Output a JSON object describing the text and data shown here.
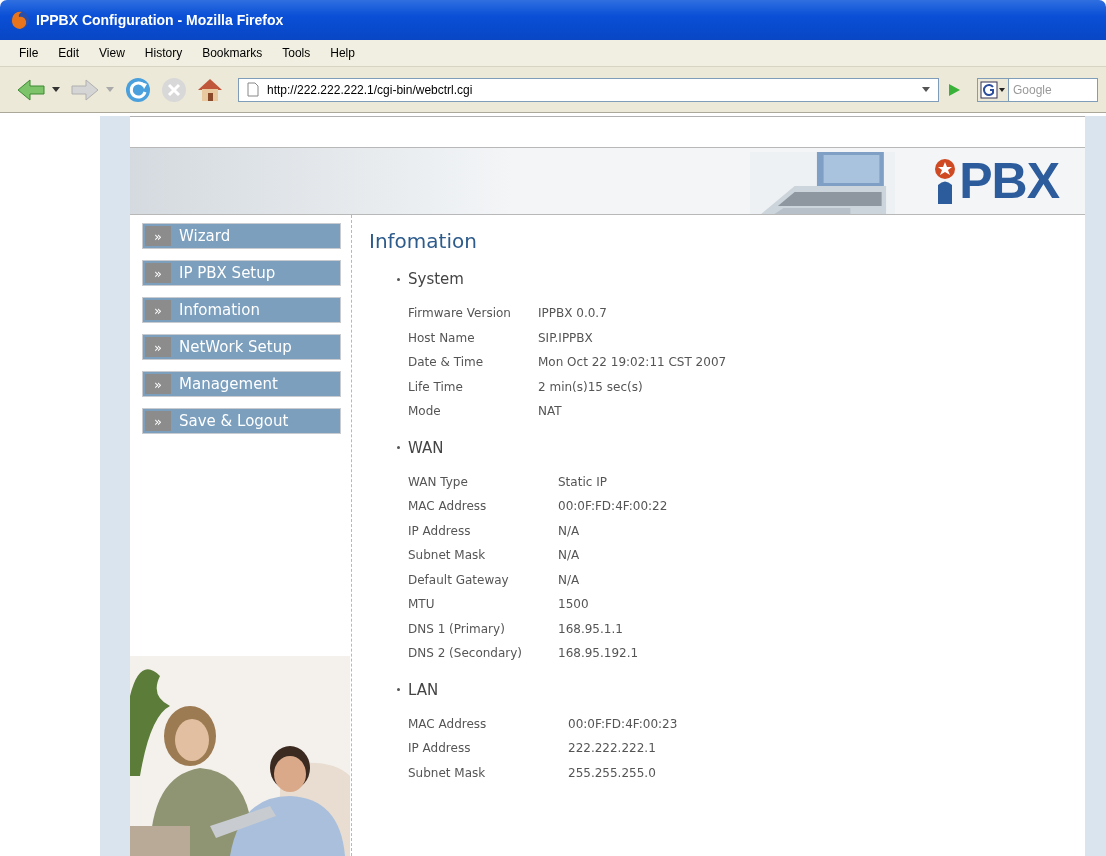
{
  "window": {
    "title": "IPPBX Configuration - Mozilla Firefox"
  },
  "menu": [
    "File",
    "Edit",
    "View",
    "History",
    "Bookmarks",
    "Tools",
    "Help"
  ],
  "address_bar": {
    "value": "http://222.222.222.1/cgi-bin/webctrl.cgi"
  },
  "search": {
    "placeholder": "Google"
  },
  "logo": {
    "text": "PBX"
  },
  "sidebar": {
    "items": [
      {
        "bullet": "»",
        "label": "Wizard"
      },
      {
        "bullet": "»",
        "label": "IP PBX Setup"
      },
      {
        "bullet": "»",
        "label": "Infomation"
      },
      {
        "bullet": "»",
        "label": "NetWork Setup"
      },
      {
        "bullet": "»",
        "label": "Management"
      },
      {
        "bullet": "»",
        "label": "Save & Logout"
      }
    ]
  },
  "content": {
    "title": "Infomation",
    "sections": [
      {
        "title": "System",
        "rows": [
          {
            "label": "Firmware Version",
            "value": "IPPBX 0.0.7"
          },
          {
            "label": "Host Name",
            "value": "SIP.IPPBX"
          },
          {
            "label": "Date & Time",
            "value": "Mon Oct 22 19:02:11 CST 2007"
          },
          {
            "label": "Life Time",
            "value": "2 min(s)15 sec(s)"
          },
          {
            "label": "Mode",
            "value": "NAT"
          }
        ]
      },
      {
        "title": "WAN",
        "rows": [
          {
            "label": "WAN Type",
            "value": "Static IP"
          },
          {
            "label": "MAC Address",
            "value": "00:0F:FD:4F:00:22"
          },
          {
            "label": "IP Address",
            "value": "N/A"
          },
          {
            "label": "Subnet Mask",
            "value": "N/A"
          },
          {
            "label": "Default Gateway",
            "value": "N/A"
          },
          {
            "label": "MTU",
            "value": "1500"
          },
          {
            "label": "DNS 1 (Primary)",
            "value": "168.95.1.1"
          },
          {
            "label": "DNS 2 (Secondary)",
            "value": "168.95.192.1"
          }
        ]
      },
      {
        "title": "LAN",
        "rows": [
          {
            "label": "MAC Address",
            "value": "00:0F:FD:4F:00:23"
          },
          {
            "label": "IP Address",
            "value": "222.222.222.1"
          },
          {
            "label": "Subnet Mask",
            "value": "255.255.255.0"
          }
        ]
      }
    ]
  }
}
